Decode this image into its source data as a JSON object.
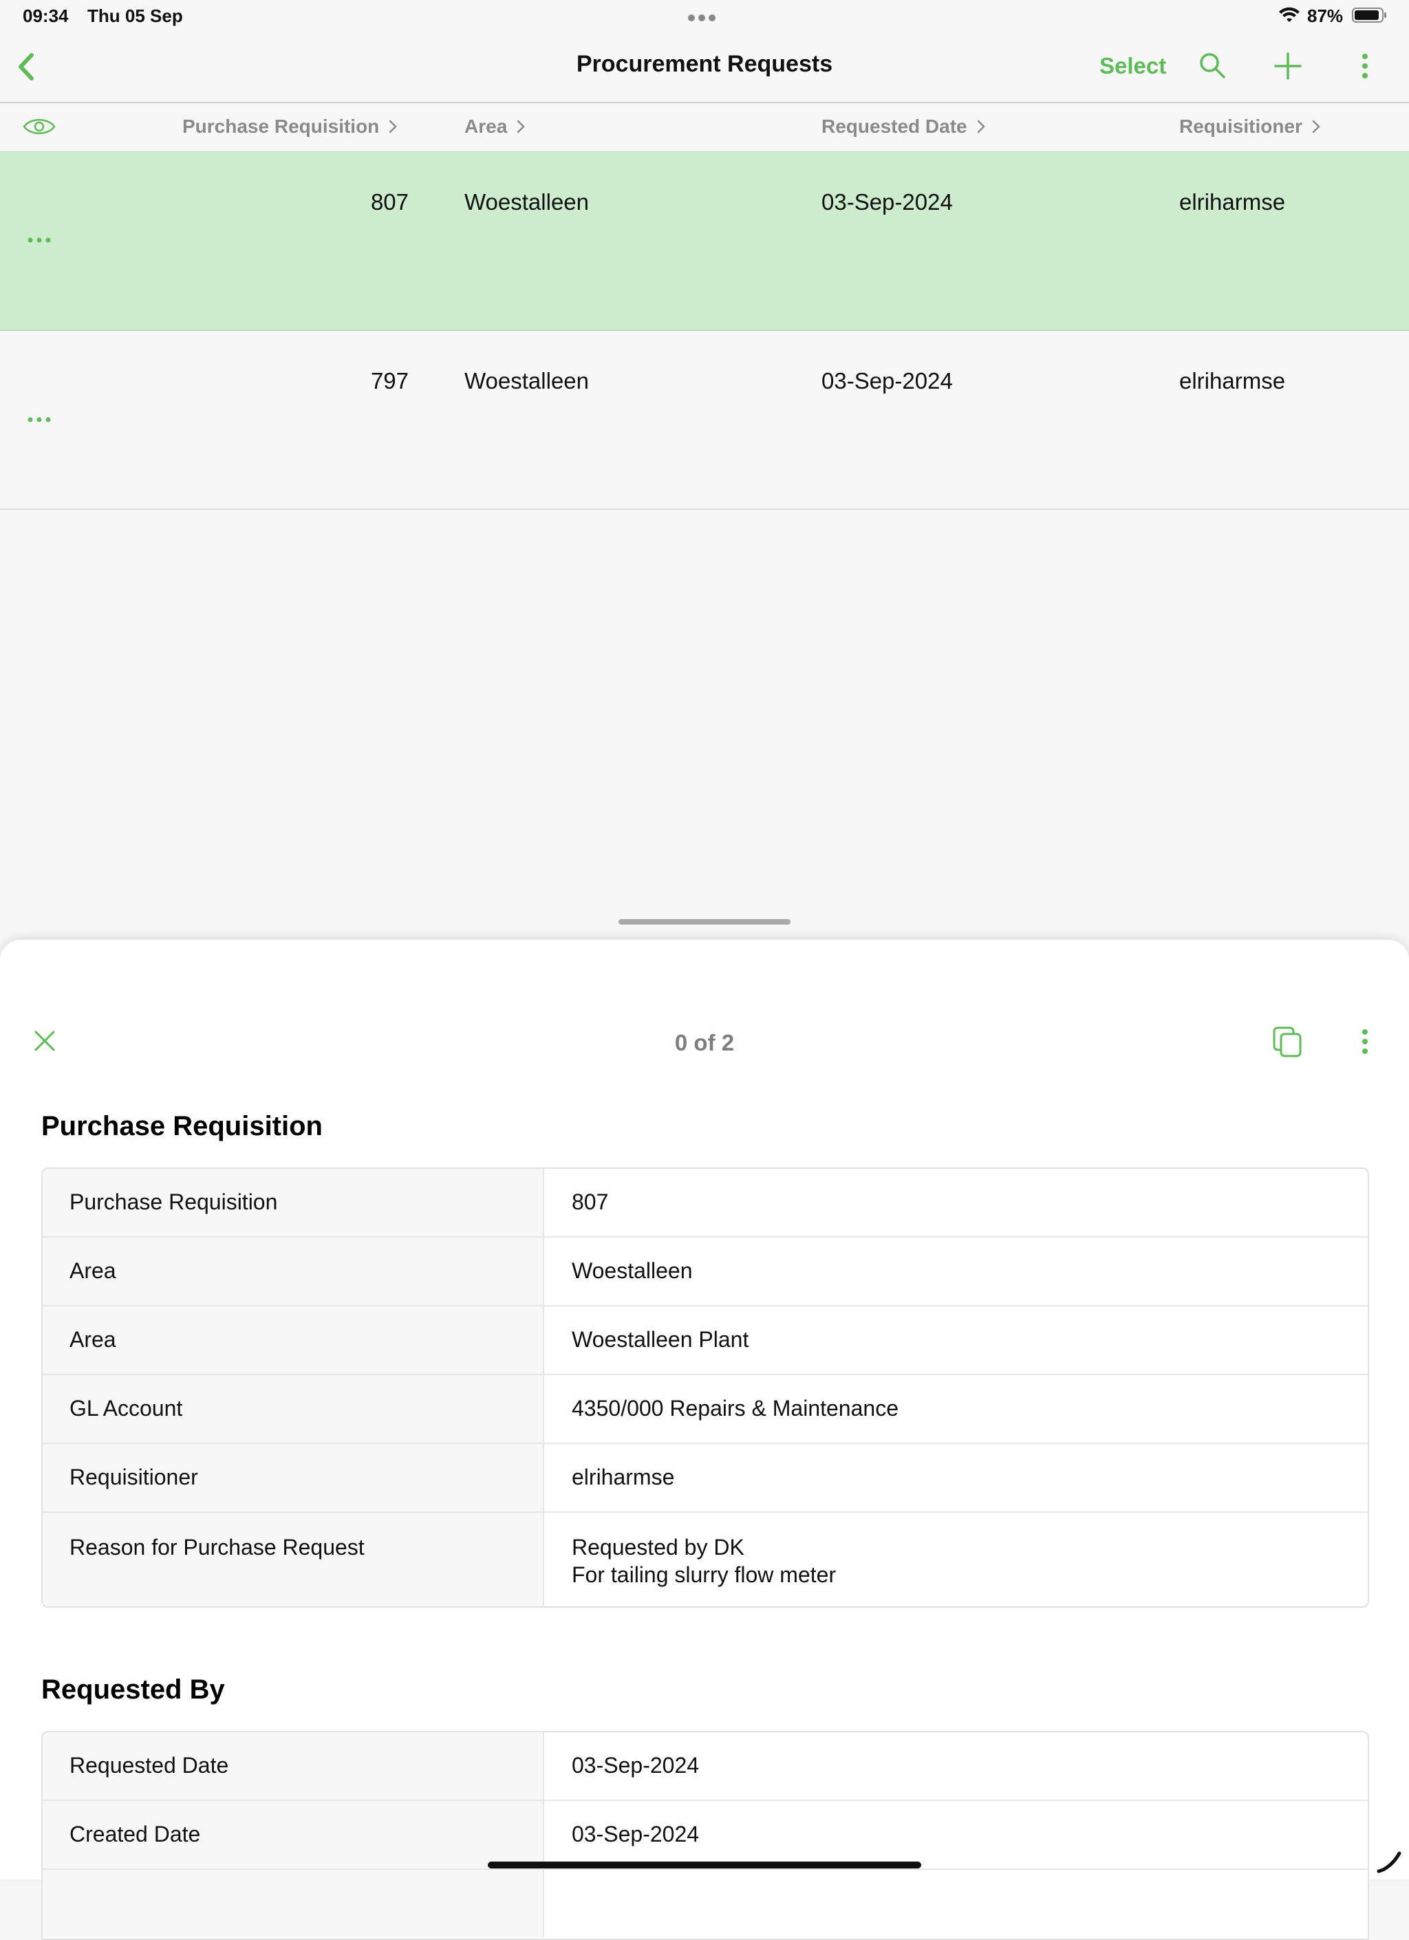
{
  "status_bar": {
    "time": "09:34",
    "date": "Thu 05 Sep",
    "battery": "87%"
  },
  "nav": {
    "title": "Procurement Requests",
    "select_label": "Select"
  },
  "table": {
    "columns": [
      "Purchase Requisition",
      "Area",
      "Requested Date",
      "Requisitioner"
    ],
    "rows": [
      {
        "purchase_requisition": "807",
        "area": "Woestalleen",
        "requested_date": "03-Sep-2024",
        "requisitioner": "elriharmse",
        "selected": true
      },
      {
        "purchase_requisition": "797",
        "area": "Woestalleen",
        "requested_date": "03-Sep-2024",
        "requisitioner": "elriharmse",
        "selected": false
      }
    ]
  },
  "sheet": {
    "counter": "0 of 2",
    "sections": [
      {
        "title": "Purchase Requisition",
        "fields": [
          {
            "label": "Purchase Requisition",
            "value": "807"
          },
          {
            "label": "Area",
            "value": "Woestalleen"
          },
          {
            "label": "Area",
            "value": "Woestalleen Plant"
          },
          {
            "label": "GL Account",
            "value": "4350/000 Repairs & Maintenance"
          },
          {
            "label": "Requisitioner",
            "value": "elriharmse"
          },
          {
            "label": "Reason for Purchase Request",
            "value_line1": "Requested by DK",
            "value_line2": "For tailing slurry flow meter"
          }
        ]
      },
      {
        "title": "Requested By",
        "fields": [
          {
            "label": "Requested Date",
            "value": "03-Sep-2024"
          },
          {
            "label": "Created Date",
            "value": "03-Sep-2024"
          }
        ]
      }
    ]
  },
  "colors": {
    "accent": "#5fbb58",
    "selected_row": "#cdecce",
    "header_text": "#8a8a8a"
  },
  "icons": [
    "back-chevron-icon",
    "search-icon",
    "plus-icon",
    "more-vertical-icon",
    "eye-icon",
    "chevron-right-icon",
    "more-horizontal-icon",
    "close-icon",
    "copy-icon",
    "wifi-icon",
    "battery-icon"
  ]
}
